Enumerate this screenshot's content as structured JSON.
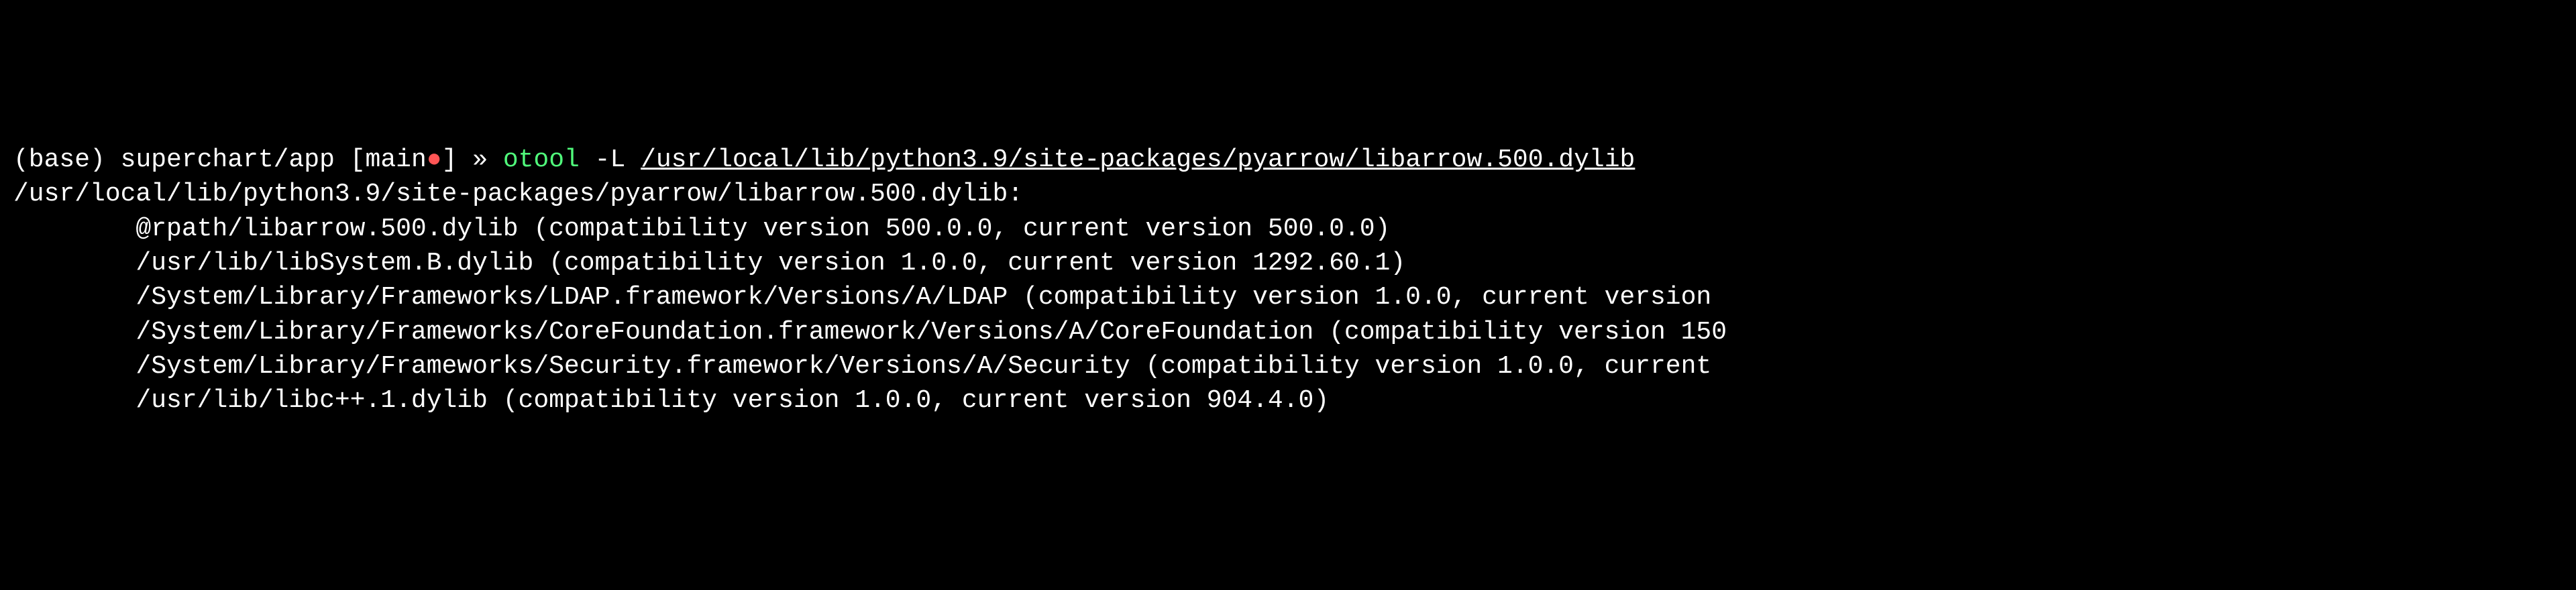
{
  "prompt": {
    "env": "(base)",
    "path": "superchart/app",
    "branch": "main",
    "dirty_marker": "●",
    "symbol": "»"
  },
  "command": {
    "name": "otool",
    "flag": "-L",
    "arg": "/usr/local/lib/python3.9/site-packages/pyarrow/libarrow.500.dylib"
  },
  "output": {
    "header": "/usr/local/lib/python3.9/site-packages/pyarrow/libarrow.500.dylib:",
    "lines": [
      "        @rpath/libarrow.500.dylib (compatibility version 500.0.0, current version 500.0.0)",
      "        /usr/lib/libSystem.B.dylib (compatibility version 1.0.0, current version 1292.60.1)",
      "        /System/Library/Frameworks/LDAP.framework/Versions/A/LDAP (compatibility version 1.0.0, current version ",
      "        /System/Library/Frameworks/CoreFoundation.framework/Versions/A/CoreFoundation (compatibility version 150",
      "        /System/Library/Frameworks/Security.framework/Versions/A/Security (compatibility version 1.0.0, current ",
      "        /usr/lib/libc++.1.dylib (compatibility version 1.0.0, current version 904.4.0)"
    ]
  }
}
